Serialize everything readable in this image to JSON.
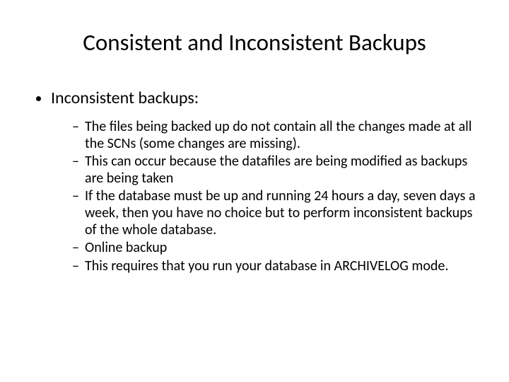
{
  "slide": {
    "title": "Consistent and Inconsistent Backups",
    "bullet1": "Inconsistent backups:",
    "sub1": "The files being backed up do not contain all the changes made at all the SCNs (some changes are missing).",
    "sub2": "This can occur because the datafiles are being modified as backups are being taken",
    "sub3": "If the database must be up and running 24 hours a day, seven days a week, then you have no choice but to perform inconsistent backups of the whole database.",
    "sub4": "Online backup",
    "sub5": "This requires that you run your database in ARCHIVELOG mode."
  }
}
